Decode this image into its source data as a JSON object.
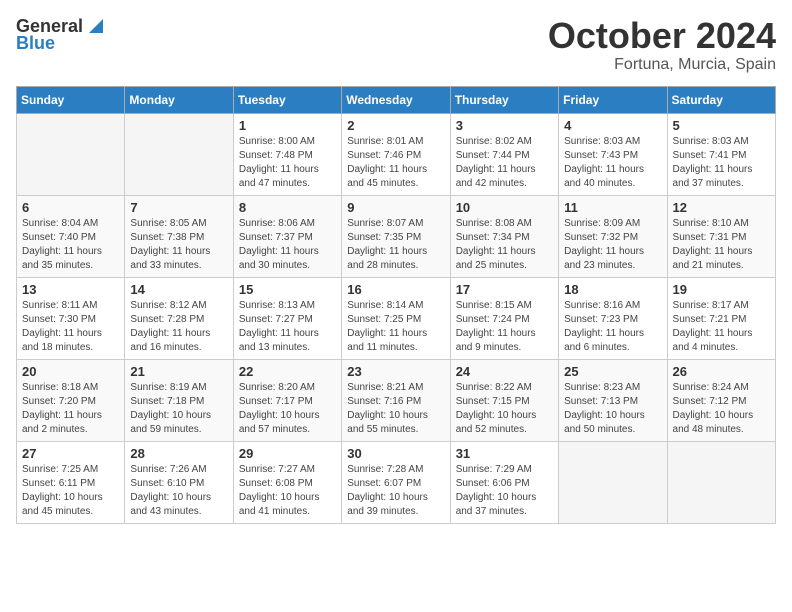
{
  "header": {
    "logo_line1": "General",
    "logo_line2": "Blue",
    "month": "October 2024",
    "location": "Fortuna, Murcia, Spain"
  },
  "weekdays": [
    "Sunday",
    "Monday",
    "Tuesday",
    "Wednesday",
    "Thursday",
    "Friday",
    "Saturday"
  ],
  "weeks": [
    [
      {
        "day": "",
        "info": ""
      },
      {
        "day": "",
        "info": ""
      },
      {
        "day": "1",
        "info": "Sunrise: 8:00 AM\nSunset: 7:48 PM\nDaylight: 11 hours and 47 minutes."
      },
      {
        "day": "2",
        "info": "Sunrise: 8:01 AM\nSunset: 7:46 PM\nDaylight: 11 hours and 45 minutes."
      },
      {
        "day": "3",
        "info": "Sunrise: 8:02 AM\nSunset: 7:44 PM\nDaylight: 11 hours and 42 minutes."
      },
      {
        "day": "4",
        "info": "Sunrise: 8:03 AM\nSunset: 7:43 PM\nDaylight: 11 hours and 40 minutes."
      },
      {
        "day": "5",
        "info": "Sunrise: 8:03 AM\nSunset: 7:41 PM\nDaylight: 11 hours and 37 minutes."
      }
    ],
    [
      {
        "day": "6",
        "info": "Sunrise: 8:04 AM\nSunset: 7:40 PM\nDaylight: 11 hours and 35 minutes."
      },
      {
        "day": "7",
        "info": "Sunrise: 8:05 AM\nSunset: 7:38 PM\nDaylight: 11 hours and 33 minutes."
      },
      {
        "day": "8",
        "info": "Sunrise: 8:06 AM\nSunset: 7:37 PM\nDaylight: 11 hours and 30 minutes."
      },
      {
        "day": "9",
        "info": "Sunrise: 8:07 AM\nSunset: 7:35 PM\nDaylight: 11 hours and 28 minutes."
      },
      {
        "day": "10",
        "info": "Sunrise: 8:08 AM\nSunset: 7:34 PM\nDaylight: 11 hours and 25 minutes."
      },
      {
        "day": "11",
        "info": "Sunrise: 8:09 AM\nSunset: 7:32 PM\nDaylight: 11 hours and 23 minutes."
      },
      {
        "day": "12",
        "info": "Sunrise: 8:10 AM\nSunset: 7:31 PM\nDaylight: 11 hours and 21 minutes."
      }
    ],
    [
      {
        "day": "13",
        "info": "Sunrise: 8:11 AM\nSunset: 7:30 PM\nDaylight: 11 hours and 18 minutes."
      },
      {
        "day": "14",
        "info": "Sunrise: 8:12 AM\nSunset: 7:28 PM\nDaylight: 11 hours and 16 minutes."
      },
      {
        "day": "15",
        "info": "Sunrise: 8:13 AM\nSunset: 7:27 PM\nDaylight: 11 hours and 13 minutes."
      },
      {
        "day": "16",
        "info": "Sunrise: 8:14 AM\nSunset: 7:25 PM\nDaylight: 11 hours and 11 minutes."
      },
      {
        "day": "17",
        "info": "Sunrise: 8:15 AM\nSunset: 7:24 PM\nDaylight: 11 hours and 9 minutes."
      },
      {
        "day": "18",
        "info": "Sunrise: 8:16 AM\nSunset: 7:23 PM\nDaylight: 11 hours and 6 minutes."
      },
      {
        "day": "19",
        "info": "Sunrise: 8:17 AM\nSunset: 7:21 PM\nDaylight: 11 hours and 4 minutes."
      }
    ],
    [
      {
        "day": "20",
        "info": "Sunrise: 8:18 AM\nSunset: 7:20 PM\nDaylight: 11 hours and 2 minutes."
      },
      {
        "day": "21",
        "info": "Sunrise: 8:19 AM\nSunset: 7:18 PM\nDaylight: 10 hours and 59 minutes."
      },
      {
        "day": "22",
        "info": "Sunrise: 8:20 AM\nSunset: 7:17 PM\nDaylight: 10 hours and 57 minutes."
      },
      {
        "day": "23",
        "info": "Sunrise: 8:21 AM\nSunset: 7:16 PM\nDaylight: 10 hours and 55 minutes."
      },
      {
        "day": "24",
        "info": "Sunrise: 8:22 AM\nSunset: 7:15 PM\nDaylight: 10 hours and 52 minutes."
      },
      {
        "day": "25",
        "info": "Sunrise: 8:23 AM\nSunset: 7:13 PM\nDaylight: 10 hours and 50 minutes."
      },
      {
        "day": "26",
        "info": "Sunrise: 8:24 AM\nSunset: 7:12 PM\nDaylight: 10 hours and 48 minutes."
      }
    ],
    [
      {
        "day": "27",
        "info": "Sunrise: 7:25 AM\nSunset: 6:11 PM\nDaylight: 10 hours and 45 minutes."
      },
      {
        "day": "28",
        "info": "Sunrise: 7:26 AM\nSunset: 6:10 PM\nDaylight: 10 hours and 43 minutes."
      },
      {
        "day": "29",
        "info": "Sunrise: 7:27 AM\nSunset: 6:08 PM\nDaylight: 10 hours and 41 minutes."
      },
      {
        "day": "30",
        "info": "Sunrise: 7:28 AM\nSunset: 6:07 PM\nDaylight: 10 hours and 39 minutes."
      },
      {
        "day": "31",
        "info": "Sunrise: 7:29 AM\nSunset: 6:06 PM\nDaylight: 10 hours and 37 minutes."
      },
      {
        "day": "",
        "info": ""
      },
      {
        "day": "",
        "info": ""
      }
    ]
  ]
}
